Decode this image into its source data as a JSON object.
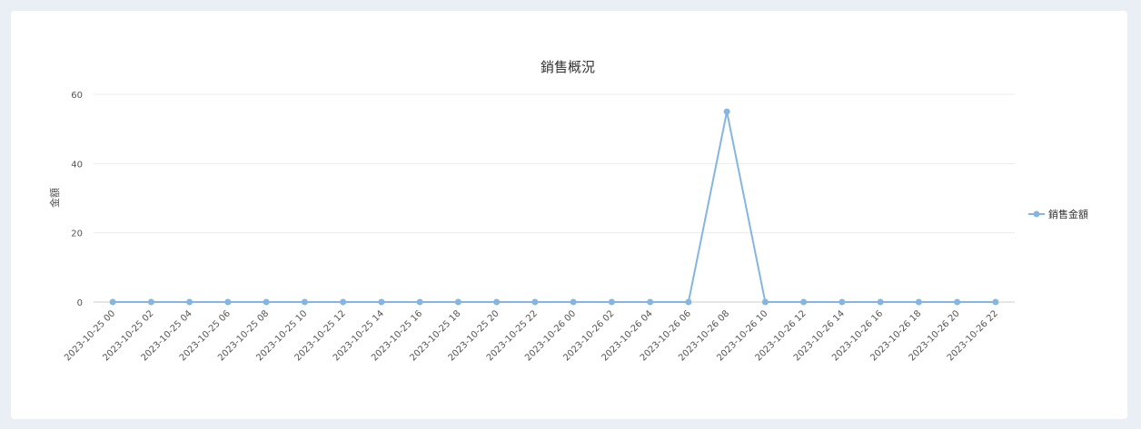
{
  "chart_data": {
    "type": "line",
    "title": "銷售概況",
    "xlabel": "",
    "ylabel": "金額",
    "ylim": [
      0,
      60
    ],
    "yticks": [
      0,
      20,
      40,
      60
    ],
    "grid": true,
    "legend_position": "right",
    "categories": [
      "2023-10-25 00",
      "2023-10-25 02",
      "2023-10-25 04",
      "2023-10-25 06",
      "2023-10-25 08",
      "2023-10-25 10",
      "2023-10-25 12",
      "2023-10-25 14",
      "2023-10-25 16",
      "2023-10-25 18",
      "2023-10-25 20",
      "2023-10-25 22",
      "2023-10-26 00",
      "2023-10-26 02",
      "2023-10-26 04",
      "2023-10-26 06",
      "2023-10-26 08",
      "2023-10-26 10",
      "2023-10-26 12",
      "2023-10-26 14",
      "2023-10-26 16",
      "2023-10-26 18",
      "2023-10-26 20",
      "2023-10-26 22"
    ],
    "series": [
      {
        "name": "銷售金額",
        "color": "#84b6df",
        "values": [
          0,
          0,
          0,
          0,
          0,
          0,
          0,
          0,
          0,
          0,
          0,
          0,
          0,
          0,
          0,
          0,
          55,
          0,
          0,
          0,
          0,
          0,
          0,
          0
        ]
      }
    ]
  }
}
